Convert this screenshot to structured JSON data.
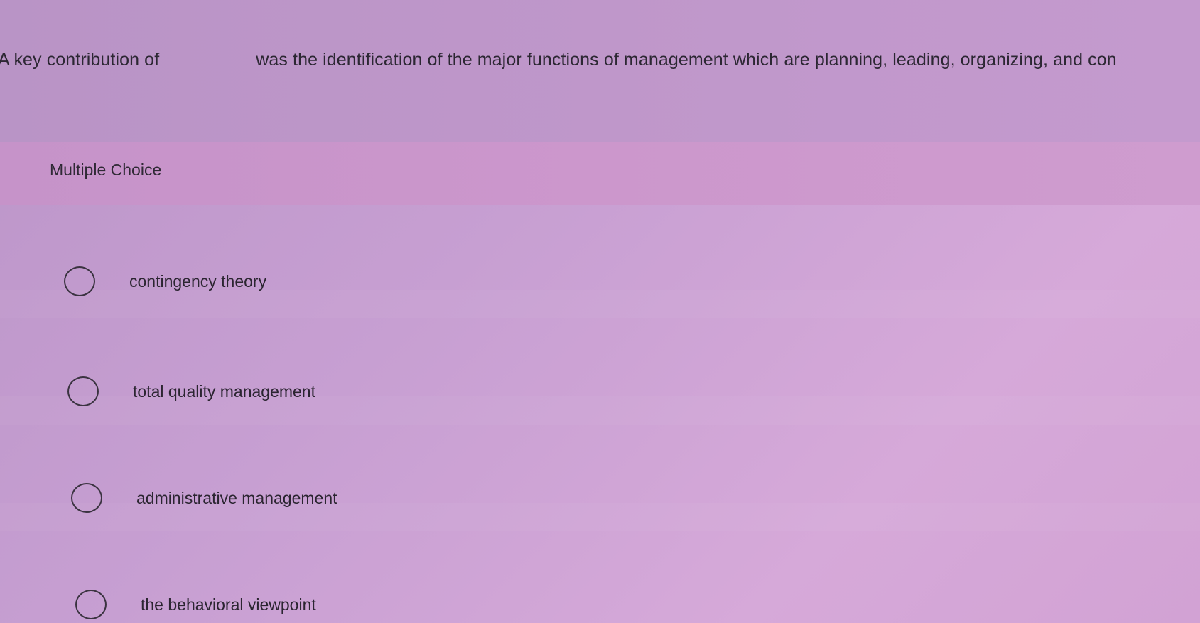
{
  "question": {
    "prefix": "A key contribution of",
    "suffix": "was the identification of the major functions of management which are planning, leading, organizing, and con"
  },
  "question_type": {
    "label": "Multiple Choice"
  },
  "options": [
    {
      "label": "contingency theory",
      "selected": false
    },
    {
      "label": "total quality management",
      "selected": false
    },
    {
      "label": "administrative management",
      "selected": false
    },
    {
      "label": "the behavioral viewpoint",
      "selected": false
    }
  ]
}
